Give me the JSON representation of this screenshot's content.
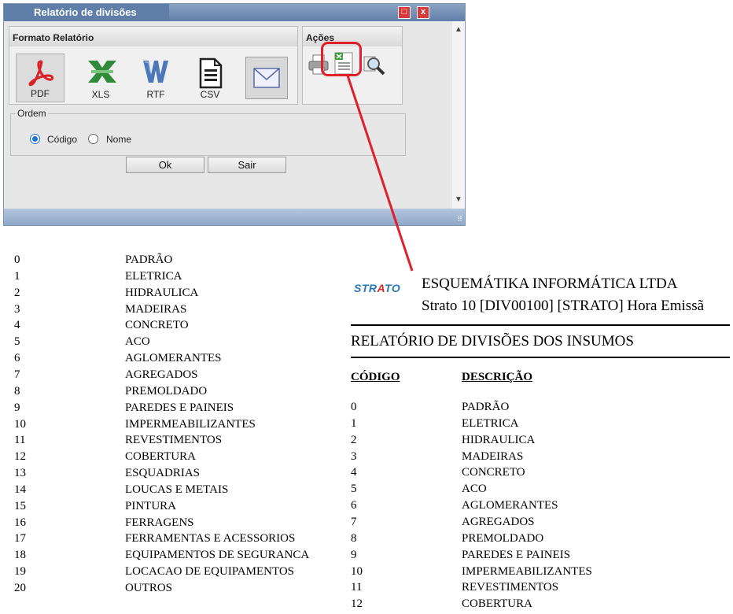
{
  "window": {
    "title": "Relatório de divisões",
    "maximize_glyph": "□",
    "close_glyph": "x"
  },
  "formato": {
    "header": "Formato Relatório",
    "options": [
      {
        "label": "PDF",
        "icon": "pdf-icon",
        "selected": true
      },
      {
        "label": "XLS",
        "icon": "excel-icon",
        "selected": false
      },
      {
        "label": "RTF",
        "icon": "word-icon",
        "selected": false
      },
      {
        "label": "CSV",
        "icon": "csv-document-icon",
        "selected": false
      },
      {
        "label": "",
        "icon": "email-envelope-icon",
        "selected": false
      }
    ]
  },
  "acoes": {
    "header": "Ações",
    "icons": [
      "printer-icon",
      "preview-report-icon",
      "search-zoom-icon"
    ],
    "highlighted": "preview-report-icon"
  },
  "ordem": {
    "legend": "Ordem",
    "options": [
      {
        "label": "Código",
        "checked": true
      },
      {
        "label": "Nome",
        "checked": false
      }
    ]
  },
  "buttons": {
    "ok": "Ok",
    "sair": "Sair"
  },
  "left_list": [
    {
      "code": "0",
      "desc": "PADRÃO"
    },
    {
      "code": "1",
      "desc": "ELETRICA"
    },
    {
      "code": "2",
      "desc": "HIDRAULICA"
    },
    {
      "code": "3",
      "desc": "MADEIRAS"
    },
    {
      "code": "4",
      "desc": "CONCRETO"
    },
    {
      "code": "5",
      "desc": "ACO"
    },
    {
      "code": "6",
      "desc": "AGLOMERANTES"
    },
    {
      "code": "7",
      "desc": "AGREGADOS"
    },
    {
      "code": "8",
      "desc": "PREMOLDADO"
    },
    {
      "code": "9",
      "desc": "PAREDES E PAINEIS"
    },
    {
      "code": "10",
      "desc": "IMPERMEABILIZANTES"
    },
    {
      "code": "11",
      "desc": "REVESTIMENTOS"
    },
    {
      "code": "12",
      "desc": "COBERTURA"
    },
    {
      "code": "13",
      "desc": "ESQUADRIAS"
    },
    {
      "code": "14",
      "desc": "LOUCAS E METAIS"
    },
    {
      "code": "15",
      "desc": "PINTURA"
    },
    {
      "code": "16",
      "desc": "FERRAGENS"
    },
    {
      "code": "17",
      "desc": "FERRAMENTAS E ACESSORIOS"
    },
    {
      "code": "18",
      "desc": "EQUIPAMENTOS DE SEGURANCA"
    },
    {
      "code": "19",
      "desc": "LOCACAO DE EQUIPAMENTOS"
    },
    {
      "code": "20",
      "desc": "OUTROS"
    }
  ],
  "report": {
    "logo_main": "STR",
    "logo_accent": "A",
    "logo_end": "TO",
    "company": "ESQUEMÁTIKA INFORMÁTICA LTDA",
    "subtitle": "Strato 10 [DIV00100] [STRATO] Hora Emissã",
    "title": "RELATÓRIO DE DIVISÕES DOS INSUMOS",
    "col_code": "CÓDIGO",
    "col_desc": "DESCRIÇÃO",
    "rows": [
      {
        "code": "0",
        "desc": "PADRÃO"
      },
      {
        "code": "1",
        "desc": "ELETRICA"
      },
      {
        "code": "2",
        "desc": "HIDRAULICA"
      },
      {
        "code": "3",
        "desc": "MADEIRAS"
      },
      {
        "code": "4",
        "desc": "CONCRETO"
      },
      {
        "code": "5",
        "desc": "ACO"
      },
      {
        "code": "6",
        "desc": "AGLOMERANTES"
      },
      {
        "code": "7",
        "desc": "AGREGADOS"
      },
      {
        "code": "8",
        "desc": "PREMOLDADO"
      },
      {
        "code": "9",
        "desc": "PAREDES E PAINEIS"
      },
      {
        "code": "10",
        "desc": "IMPERMEABILIZANTES"
      },
      {
        "code": "11",
        "desc": "REVESTIMENTOS"
      },
      {
        "code": "12",
        "desc": "COBERTURA"
      }
    ]
  },
  "colors": {
    "highlight": "#e0202a",
    "titlebar": "#5f7fa9",
    "radio": "#1f6fd6"
  }
}
